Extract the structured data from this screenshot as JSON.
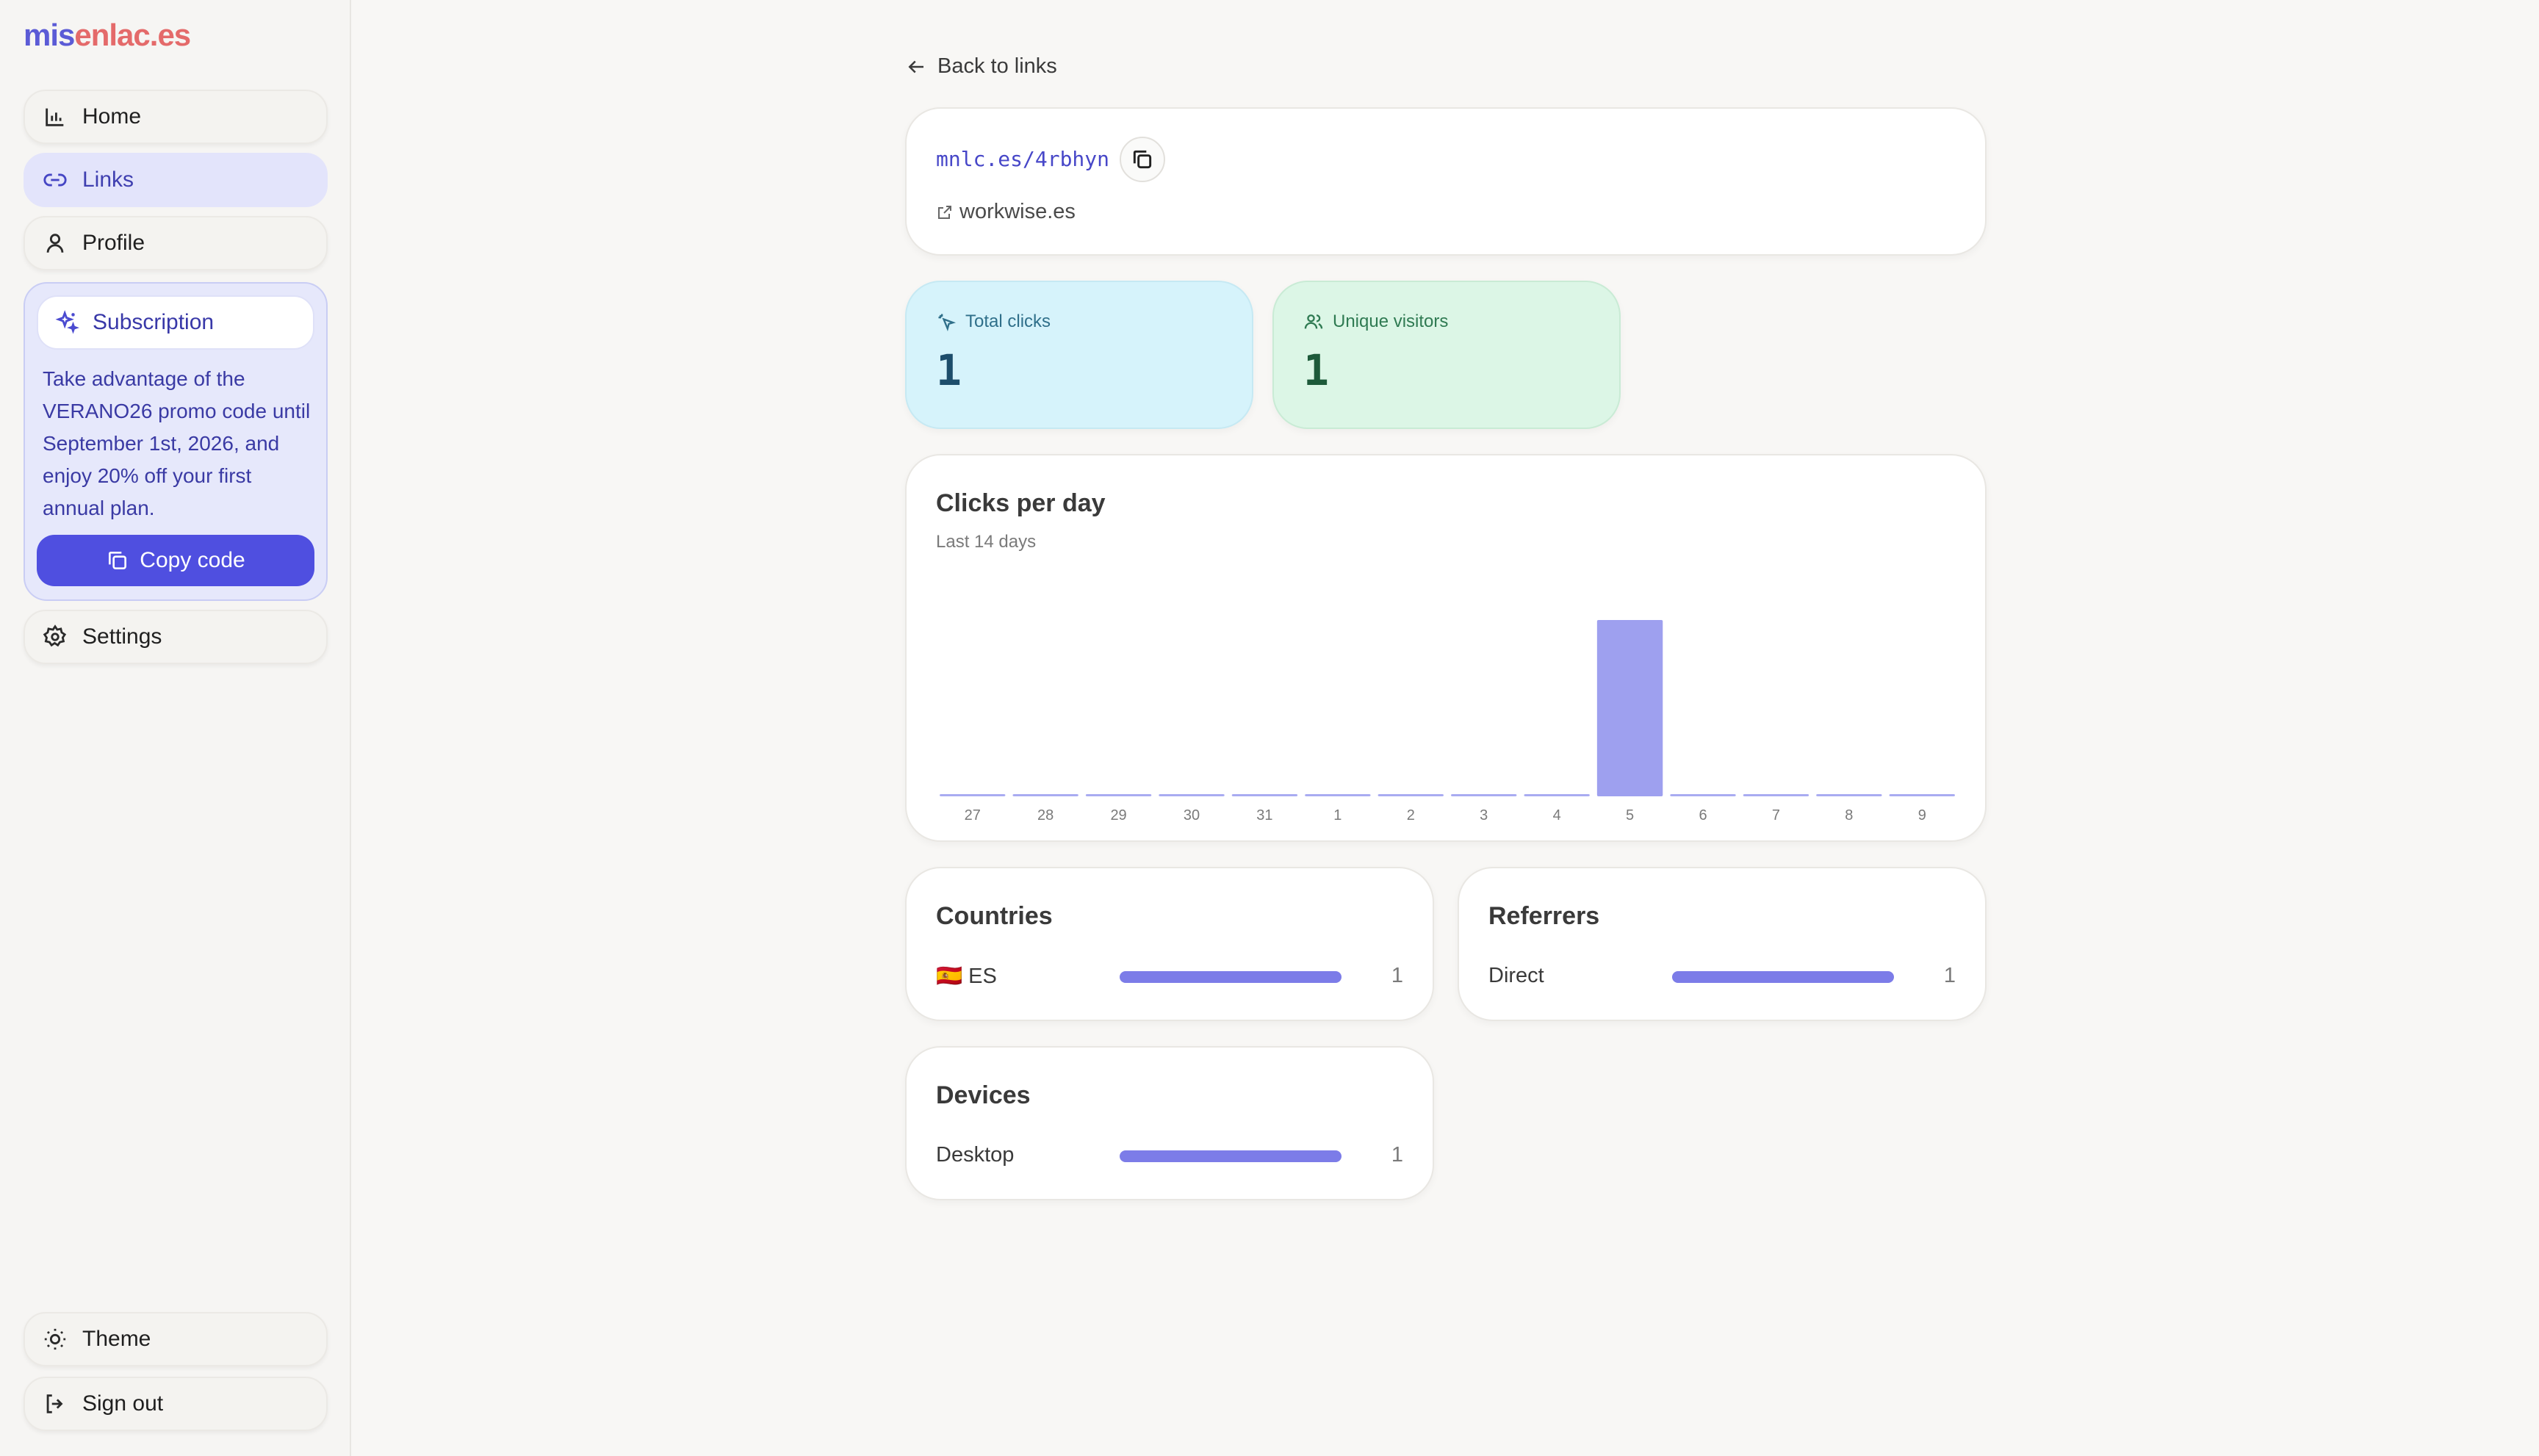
{
  "brand": {
    "part1": "mis",
    "part2": "enlac.es"
  },
  "sidebar": {
    "items": [
      {
        "label": "Home",
        "icon": "bar-chart-icon"
      },
      {
        "label": "Links",
        "icon": "link-icon"
      },
      {
        "label": "Profile",
        "icon": "user-icon"
      }
    ],
    "subscription": {
      "label": "Subscription",
      "icon": "sparkles-icon",
      "promo": "Take advantage of the VERANO26 promo code until September 1st, 2026, and enjoy 20% off your first annual plan.",
      "button": "Copy code"
    },
    "settings": "Settings",
    "theme": "Theme",
    "signout": "Sign out"
  },
  "back": "Back to links",
  "link": {
    "short": "mnlc.es/4rbhyn",
    "destination": "workwise.es"
  },
  "stats": {
    "total_clicks": {
      "label": "Total clicks",
      "value": "1"
    },
    "unique_visitors": {
      "label": "Unique visitors",
      "value": "1"
    }
  },
  "clicks_card": {
    "title": "Clicks per day",
    "subtitle": "Last 14 days"
  },
  "chart_data": {
    "type": "bar",
    "title": "Clicks per day",
    "subtitle": "Last 14 days",
    "categories": [
      "27",
      "28",
      "29",
      "30",
      "31",
      "1",
      "2",
      "3",
      "4",
      "5",
      "6",
      "7",
      "8",
      "9"
    ],
    "values": [
      0,
      0,
      0,
      0,
      0,
      0,
      0,
      0,
      0,
      1,
      0,
      0,
      0,
      0
    ],
    "ylim": [
      0,
      1
    ],
    "grid": false,
    "color": "#9ea0ef"
  },
  "countries": {
    "title": "Countries",
    "rows": [
      {
        "label": "🇪🇸 ES",
        "count": "1",
        "fraction": 1
      }
    ]
  },
  "referrers": {
    "title": "Referrers",
    "rows": [
      {
        "label": "Direct",
        "count": "1",
        "fraction": 1
      }
    ]
  },
  "devices": {
    "title": "Devices",
    "rows": [
      {
        "label": "Desktop",
        "count": "1",
        "fraction": 1
      }
    ]
  },
  "colors": {
    "accent": "#4f4fe0",
    "bar": "#7c7ce8",
    "chart_bar": "#9ea0ef"
  }
}
